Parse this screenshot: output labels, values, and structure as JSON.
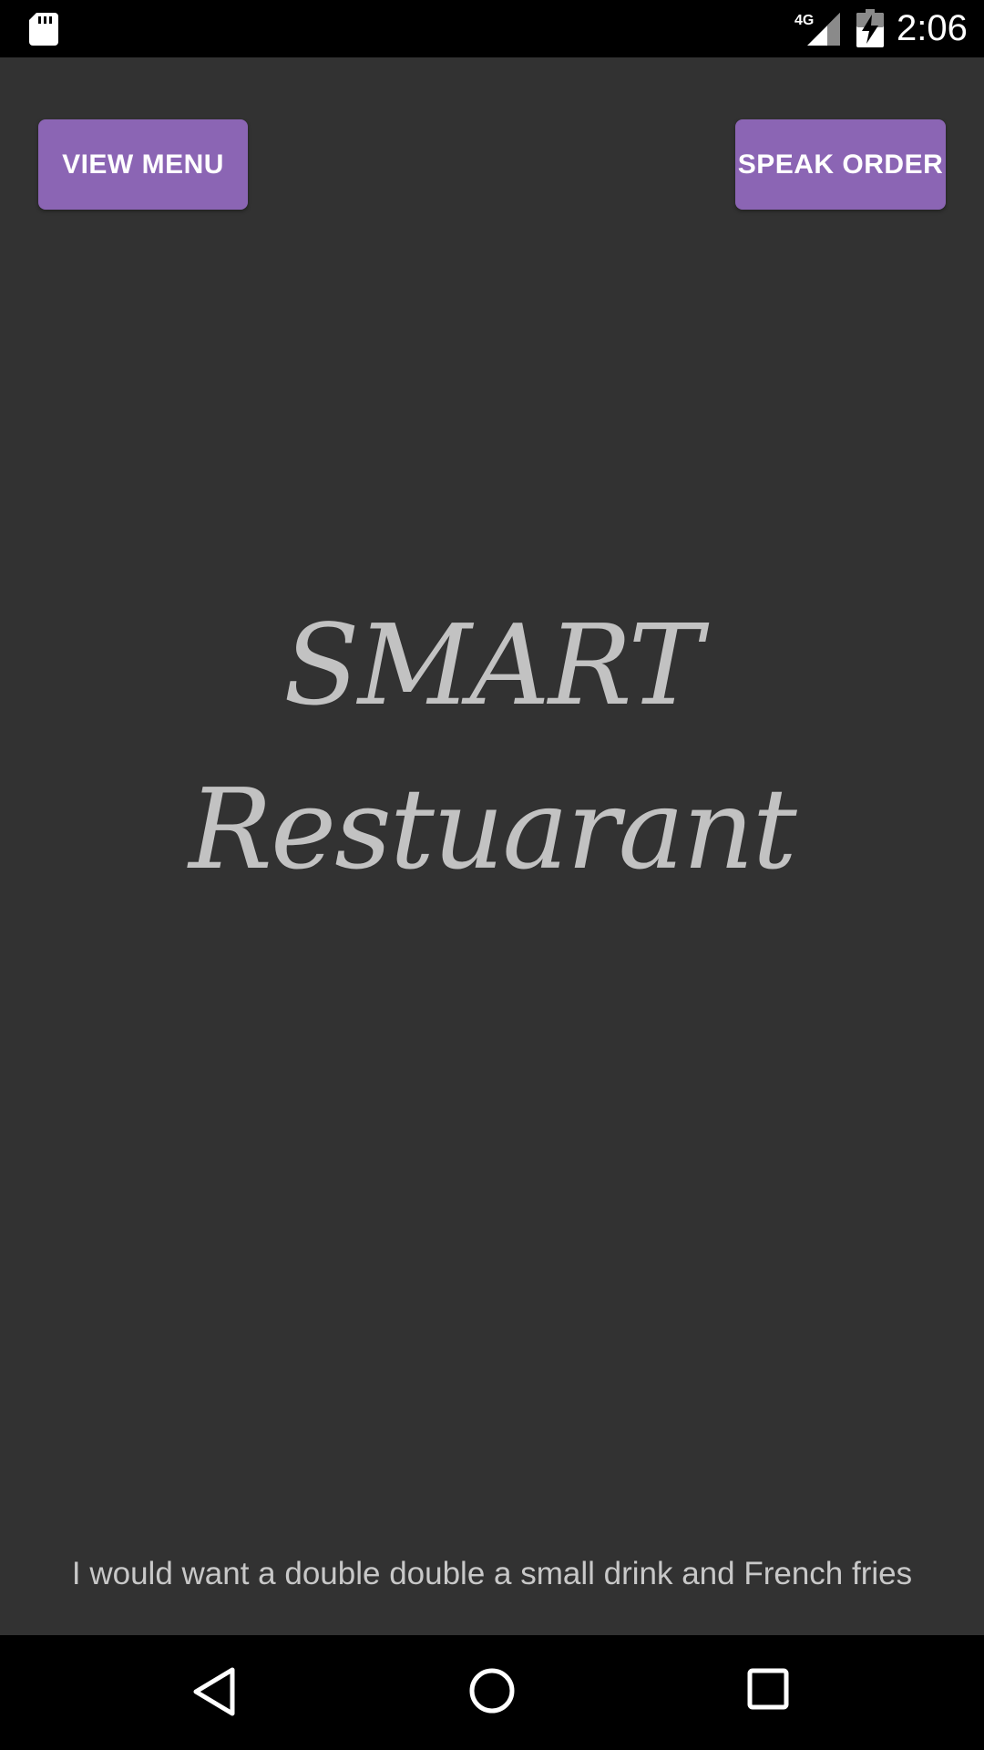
{
  "status_bar": {
    "network_label": "4G",
    "time": "2:06",
    "icons": [
      "sd-card-icon",
      "signal-icon",
      "battery-charging-icon"
    ]
  },
  "buttons": {
    "view_menu": "VIEW MENU",
    "speak_order": "SPEAK ORDER"
  },
  "title": "SMART Restuarant",
  "order_text": "I would want a double double a small drink and French fries",
  "navigation": {
    "icons": [
      "back-icon",
      "home-icon",
      "recents-icon"
    ]
  },
  "colors": {
    "background": "#323232",
    "accent": "#8b65b4",
    "title_text": "#c2c2c2",
    "bars": "#000000"
  }
}
